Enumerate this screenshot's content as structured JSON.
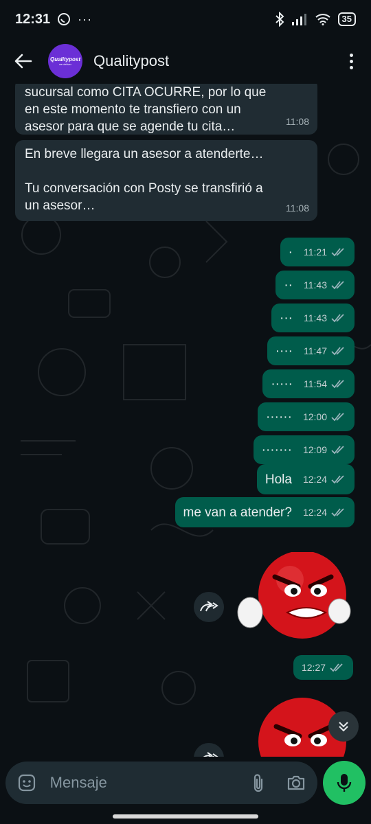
{
  "status_bar": {
    "time": "12:31",
    "battery": "35"
  },
  "header": {
    "contact_name": "Qualitypost",
    "avatar_main": "Qualitypost",
    "avatar_sub": "we deliver"
  },
  "messages_in": [
    {
      "text": "sucursal como CITA OCURRE, por lo que en este momento te transfiero con un asesor para que se agende tu cita…",
      "time": "11:08"
    },
    {
      "text_line1": "En breve llegara un asesor a atenderte…",
      "text_line2": "Tu conversación con Posty se transfirió a un asesor…",
      "time": "11:08"
    }
  ],
  "messages_out": [
    {
      "text": "·",
      "time": "11:21"
    },
    {
      "text": "··",
      "time": "11:43"
    },
    {
      "text": "···",
      "time": "11:43"
    },
    {
      "text": "····",
      "time": "11:47"
    },
    {
      "text": "·····",
      "time": "11:54"
    },
    {
      "text": "······",
      "time": "12:00"
    },
    {
      "text": "·······",
      "time": "12:09"
    },
    {
      "text": "Hola",
      "time": "12:24"
    },
    {
      "text": "me van a atender?",
      "time": "12:24"
    }
  ],
  "sticker": {
    "time": "12:27"
  },
  "compose": {
    "placeholder": "Mensaje"
  },
  "colors": {
    "incoming": "#202c33",
    "outgoing": "#005c4b",
    "accent": "#21c063",
    "ticks": "#9bb5bd"
  }
}
